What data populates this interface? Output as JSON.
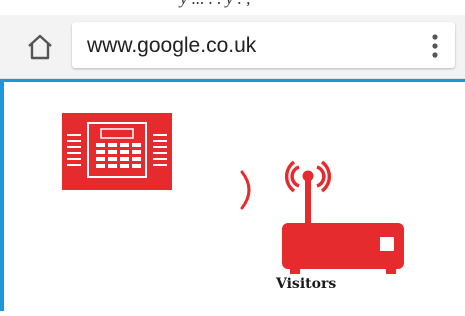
{
  "browser": {
    "url": "www.google.co.uk",
    "home_icon": "home-icon",
    "menu_icon": "more-vert-icon"
  },
  "scene": {
    "caption": "Visitors",
    "icons": [
      "alarm-panel-icon",
      "signal-wave-icon",
      "router-icon"
    ],
    "accent_color": "#e62b2e"
  },
  "colors": {
    "toolbar_bg": "#f3f3f3",
    "page_border": "#1d97d8",
    "accent": "#e62b2e"
  }
}
